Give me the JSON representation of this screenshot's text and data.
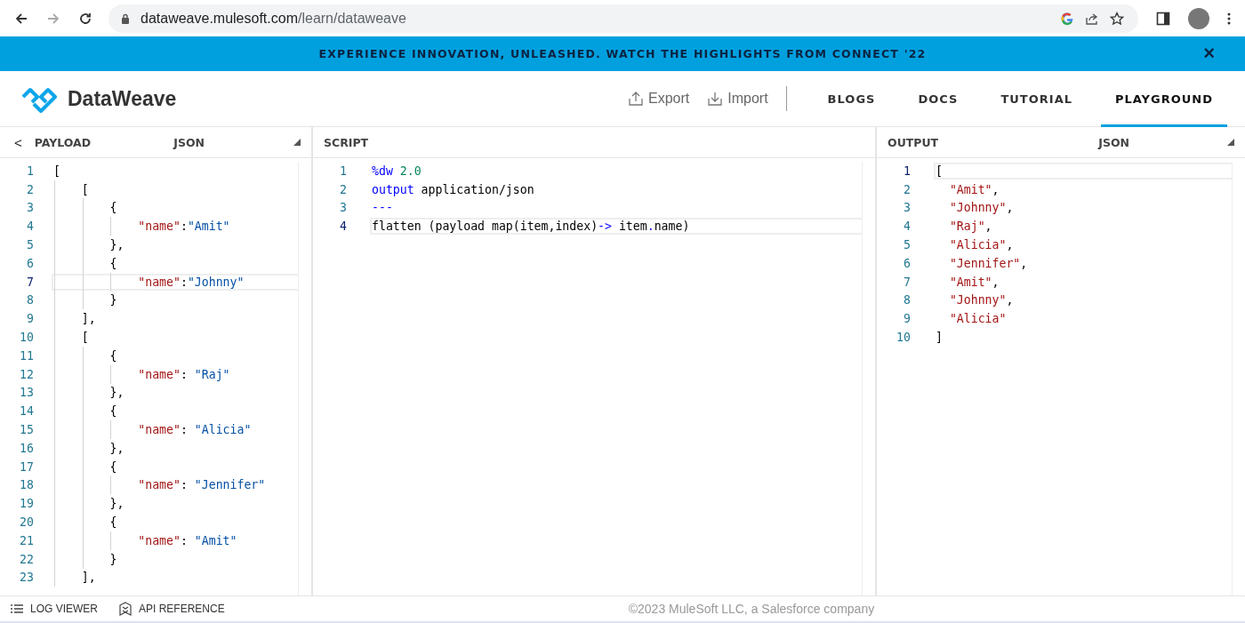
{
  "browser": {
    "url_host": "dataweave.mulesoft.com",
    "url_path": "/learn/dataweave"
  },
  "banner": {
    "text": "EXPERIENCE INNOVATION, UNLEASHED. WATCH THE HIGHLIGHTS FROM CONNECT '22",
    "close": "×"
  },
  "header": {
    "logo": "DataWeave",
    "actions": [
      "Export",
      "Import"
    ],
    "nav": [
      {
        "label": "BLOGS",
        "selected": false
      },
      {
        "label": "DOCS",
        "selected": false
      },
      {
        "label": "TUTORIAL",
        "selected": false
      },
      {
        "label": "PLAYGROUND",
        "selected": true
      }
    ]
  },
  "payload": {
    "back": "<",
    "title": "PAYLOAD",
    "format": "JSON",
    "lines": [
      {
        "number": "1",
        "highlighted": false,
        "tokens": [
          {
            "text": "[",
            "kind": "text"
          }
        ]
      },
      {
        "number": "2",
        "highlighted": false,
        "tokens": [
          {
            "text": "    [",
            "kind": "text"
          }
        ]
      },
      {
        "number": "3",
        "highlighted": false,
        "tokens": [
          {
            "text": "        {",
            "kind": "text"
          }
        ]
      },
      {
        "number": "4",
        "highlighted": false,
        "tokens": [
          {
            "text": "            \"name\"",
            "kind": "key"
          },
          {
            "text": ":",
            "kind": "text"
          },
          {
            "text": "\"Amit\"",
            "kind": "string"
          }
        ]
      },
      {
        "number": "5",
        "highlighted": false,
        "tokens": [
          {
            "text": "        },",
            "kind": "text"
          }
        ]
      },
      {
        "number": "6",
        "highlighted": false,
        "tokens": [
          {
            "text": "        {",
            "kind": "text"
          }
        ]
      },
      {
        "number": "7",
        "highlighted": true,
        "tokens": [
          {
            "text": "            \"name\"",
            "kind": "key"
          },
          {
            "text": ":",
            "kind": "text"
          },
          {
            "text": "\"Johnny\"",
            "kind": "string"
          }
        ]
      },
      {
        "number": "8",
        "highlighted": false,
        "tokens": [
          {
            "text": "        }",
            "kind": "text"
          }
        ]
      },
      {
        "number": "9",
        "highlighted": false,
        "tokens": [
          {
            "text": "    ],",
            "kind": "text"
          }
        ]
      },
      {
        "number": "10",
        "highlighted": false,
        "tokens": [
          {
            "text": "    [",
            "kind": "text"
          }
        ]
      },
      {
        "number": "11",
        "highlighted": false,
        "tokens": [
          {
            "text": "        {",
            "kind": "text"
          }
        ]
      },
      {
        "number": "12",
        "highlighted": false,
        "tokens": [
          {
            "text": "            \"name\"",
            "kind": "key"
          },
          {
            "text": ": ",
            "kind": "text"
          },
          {
            "text": "\"Raj\"",
            "kind": "string"
          }
        ]
      },
      {
        "number": "13",
        "highlighted": false,
        "tokens": [
          {
            "text": "        },",
            "kind": "text"
          }
        ]
      },
      {
        "number": "14",
        "highlighted": false,
        "tokens": [
          {
            "text": "        {",
            "kind": "text"
          }
        ]
      },
      {
        "number": "15",
        "highlighted": false,
        "tokens": [
          {
            "text": "            \"name\"",
            "kind": "key"
          },
          {
            "text": ": ",
            "kind": "text"
          },
          {
            "text": "\"Alicia\"",
            "kind": "string"
          }
        ]
      },
      {
        "number": "16",
        "highlighted": false,
        "tokens": [
          {
            "text": "        },",
            "kind": "text"
          }
        ]
      },
      {
        "number": "17",
        "highlighted": false,
        "tokens": [
          {
            "text": "        {",
            "kind": "text"
          }
        ]
      },
      {
        "number": "18",
        "highlighted": false,
        "tokens": [
          {
            "text": "            \"name\"",
            "kind": "key"
          },
          {
            "text": ": ",
            "kind": "text"
          },
          {
            "text": "\"Jennifer\"",
            "kind": "string"
          }
        ]
      },
      {
        "number": "19",
        "highlighted": false,
        "tokens": [
          {
            "text": "        },",
            "kind": "text"
          }
        ]
      },
      {
        "number": "20",
        "highlighted": false,
        "tokens": [
          {
            "text": "        {",
            "kind": "text"
          }
        ]
      },
      {
        "number": "21",
        "highlighted": false,
        "tokens": [
          {
            "text": "            \"name\"",
            "kind": "key"
          },
          {
            "text": ": ",
            "kind": "text"
          },
          {
            "text": "\"Amit\"",
            "kind": "string"
          }
        ]
      },
      {
        "number": "22",
        "highlighted": false,
        "tokens": [
          {
            "text": "        }",
            "kind": "text"
          }
        ]
      },
      {
        "number": "23",
        "highlighted": false,
        "tokens": [
          {
            "text": "    ],",
            "kind": "text"
          }
        ]
      }
    ]
  },
  "script": {
    "title": "SCRIPT",
    "lines": [
      {
        "number": "1",
        "highlighted": false,
        "tokens": [
          {
            "text": "%dw",
            "kind": "keyword"
          },
          {
            "text": " 2.0",
            "kind": "number"
          }
        ]
      },
      {
        "number": "2",
        "highlighted": false,
        "tokens": [
          {
            "text": "output",
            "kind": "keyword"
          },
          {
            "text": " application/json",
            "kind": "text"
          }
        ]
      },
      {
        "number": "3",
        "highlighted": false,
        "tokens": [
          {
            "text": "---",
            "kind": "keyword"
          }
        ]
      },
      {
        "number": "4",
        "highlighted": true,
        "tokens": [
          {
            "text": "flatten (payload map(item,index)",
            "kind": "text"
          },
          {
            "text": "->",
            "kind": "keyword"
          },
          {
            "text": " item",
            "kind": "text"
          },
          {
            "text": ".",
            "kind": "keyword"
          },
          {
            "text": "name)",
            "kind": "text"
          }
        ]
      }
    ]
  },
  "output": {
    "title": "OUTPUT",
    "format": "JSON",
    "lines": [
      {
        "number": "1",
        "highlighted": true,
        "tokens": [
          {
            "text": "[",
            "kind": "text"
          }
        ]
      },
      {
        "number": "2",
        "highlighted": false,
        "tokens": [
          {
            "text": "  \"Amit\"",
            "kind": "key"
          },
          {
            "text": ",",
            "kind": "text"
          }
        ]
      },
      {
        "number": "3",
        "highlighted": false,
        "tokens": [
          {
            "text": "  \"Johnny\"",
            "kind": "key"
          },
          {
            "text": ",",
            "kind": "text"
          }
        ]
      },
      {
        "number": "4",
        "highlighted": false,
        "tokens": [
          {
            "text": "  \"Raj\"",
            "kind": "key"
          },
          {
            "text": ",",
            "kind": "text"
          }
        ]
      },
      {
        "number": "5",
        "highlighted": false,
        "tokens": [
          {
            "text": "  \"Alicia\"",
            "kind": "key"
          },
          {
            "text": ",",
            "kind": "text"
          }
        ]
      },
      {
        "number": "6",
        "highlighted": false,
        "tokens": [
          {
            "text": "  \"Jennifer\"",
            "kind": "key"
          },
          {
            "text": ",",
            "kind": "text"
          }
        ]
      },
      {
        "number": "7",
        "highlighted": false,
        "tokens": [
          {
            "text": "  \"Amit\"",
            "kind": "key"
          },
          {
            "text": ",",
            "kind": "text"
          }
        ]
      },
      {
        "number": "8",
        "highlighted": false,
        "tokens": [
          {
            "text": "  \"Johnny\"",
            "kind": "key"
          },
          {
            "text": ",",
            "kind": "text"
          }
        ]
      },
      {
        "number": "9",
        "highlighted": false,
        "tokens": [
          {
            "text": "  \"Alicia\"",
            "kind": "key"
          }
        ]
      },
      {
        "number": "10",
        "highlighted": false,
        "tokens": [
          {
            "text": "]",
            "kind": "text"
          }
        ]
      }
    ]
  },
  "footer": {
    "tools": [
      "LOG VIEWER",
      "API REFERENCE"
    ],
    "copyright": "©2023 MuleSoft LLC, a Salesforce company"
  }
}
